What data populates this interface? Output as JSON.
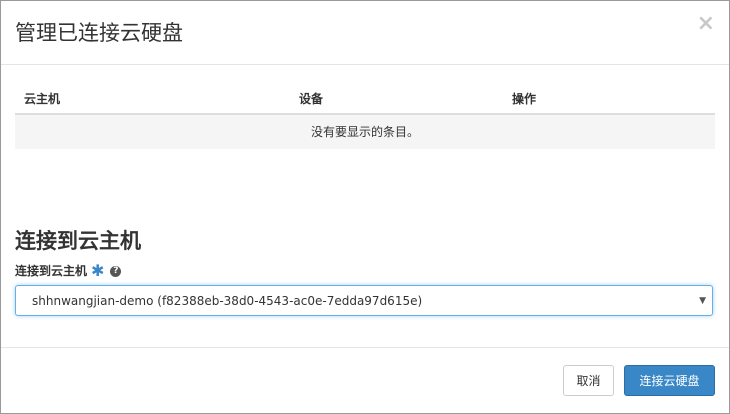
{
  "modal": {
    "title": "管理已连接云硬盘",
    "close_glyph": "×"
  },
  "table": {
    "columns": [
      "云主机",
      "设备",
      "操作"
    ],
    "empty_message": "没有要显示的条目。"
  },
  "attach_section": {
    "title": "连接到云主机",
    "field_label": "连接到云主机",
    "required_mark": "✱",
    "help_glyph": "?",
    "selected_instance": "shhnwangjian-demo (f82388eb-38d0-4543-ac0e-7edda97d615e)",
    "arrow_glyph": "▼"
  },
  "footer": {
    "cancel_label": "取消",
    "submit_label": "连接云硬盘"
  },
  "colors": {
    "primary": "#3a87c8",
    "focus_border": "#66afe9"
  }
}
